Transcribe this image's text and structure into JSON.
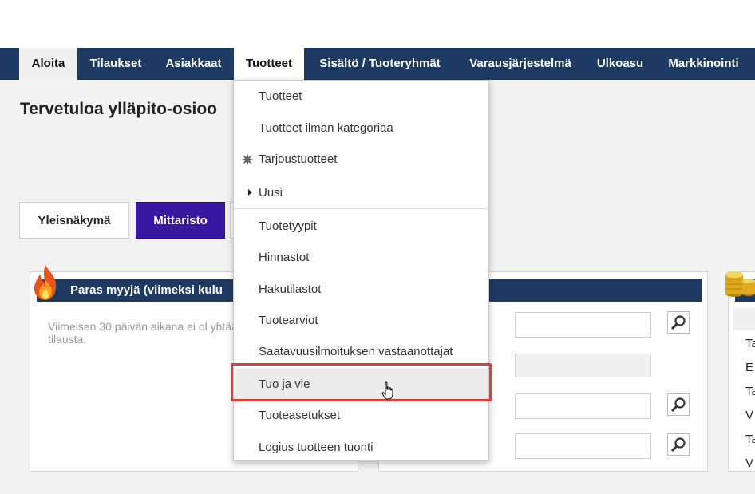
{
  "nav": {
    "items": [
      {
        "label": "Aloita"
      },
      {
        "label": "Tilaukset"
      },
      {
        "label": "Asiakkaat"
      },
      {
        "label": "Tuotteet"
      },
      {
        "label": "Sisältö / Tuoteryhmät"
      },
      {
        "label": "Varausjärjestelmä"
      },
      {
        "label": "Ulkoasu"
      },
      {
        "label": "Markkinointi"
      }
    ],
    "active_index": 3
  },
  "welcome_title": "Tervetuloa ylläpito-osioo",
  "tabs": [
    {
      "label": "Yleisnäkymä"
    },
    {
      "label": "Mittaristo"
    }
  ],
  "panels": {
    "bestseller": {
      "title": "Paras myyjä (viimeksi kulu",
      "message": "Viimeisen 30 päivän aikana ei ol yhtään tilausta."
    },
    "right_letters": [
      "Ta",
      "E",
      "Ta",
      "V",
      "Ta",
      "V"
    ]
  },
  "dropdown": {
    "items": [
      {
        "label": "Tuotteet"
      },
      {
        "label": "Tuotteet ilman kategoriaa"
      },
      {
        "label": "Tarjoustuotteet",
        "icon": "starburst-icon"
      },
      {
        "label": "Uusi",
        "icon": "submenu-arrow-icon"
      },
      {
        "label": "Tuotetyypit"
      },
      {
        "label": "Hinnastot"
      },
      {
        "label": "Hakutilastot"
      },
      {
        "label": "Tuotearviot"
      },
      {
        "label": "Saatavuusilmoituksen vastaanottajat"
      },
      {
        "label": "Tuo ja vie"
      },
      {
        "label": "Tuoteasetukset"
      },
      {
        "label": "Logius tuotteen tuonti"
      }
    ],
    "highlighted_index": 9
  },
  "colors": {
    "nav_bg": "#1d3a63",
    "tab_active": "#3b16a0",
    "highlight": "#d9403a"
  }
}
